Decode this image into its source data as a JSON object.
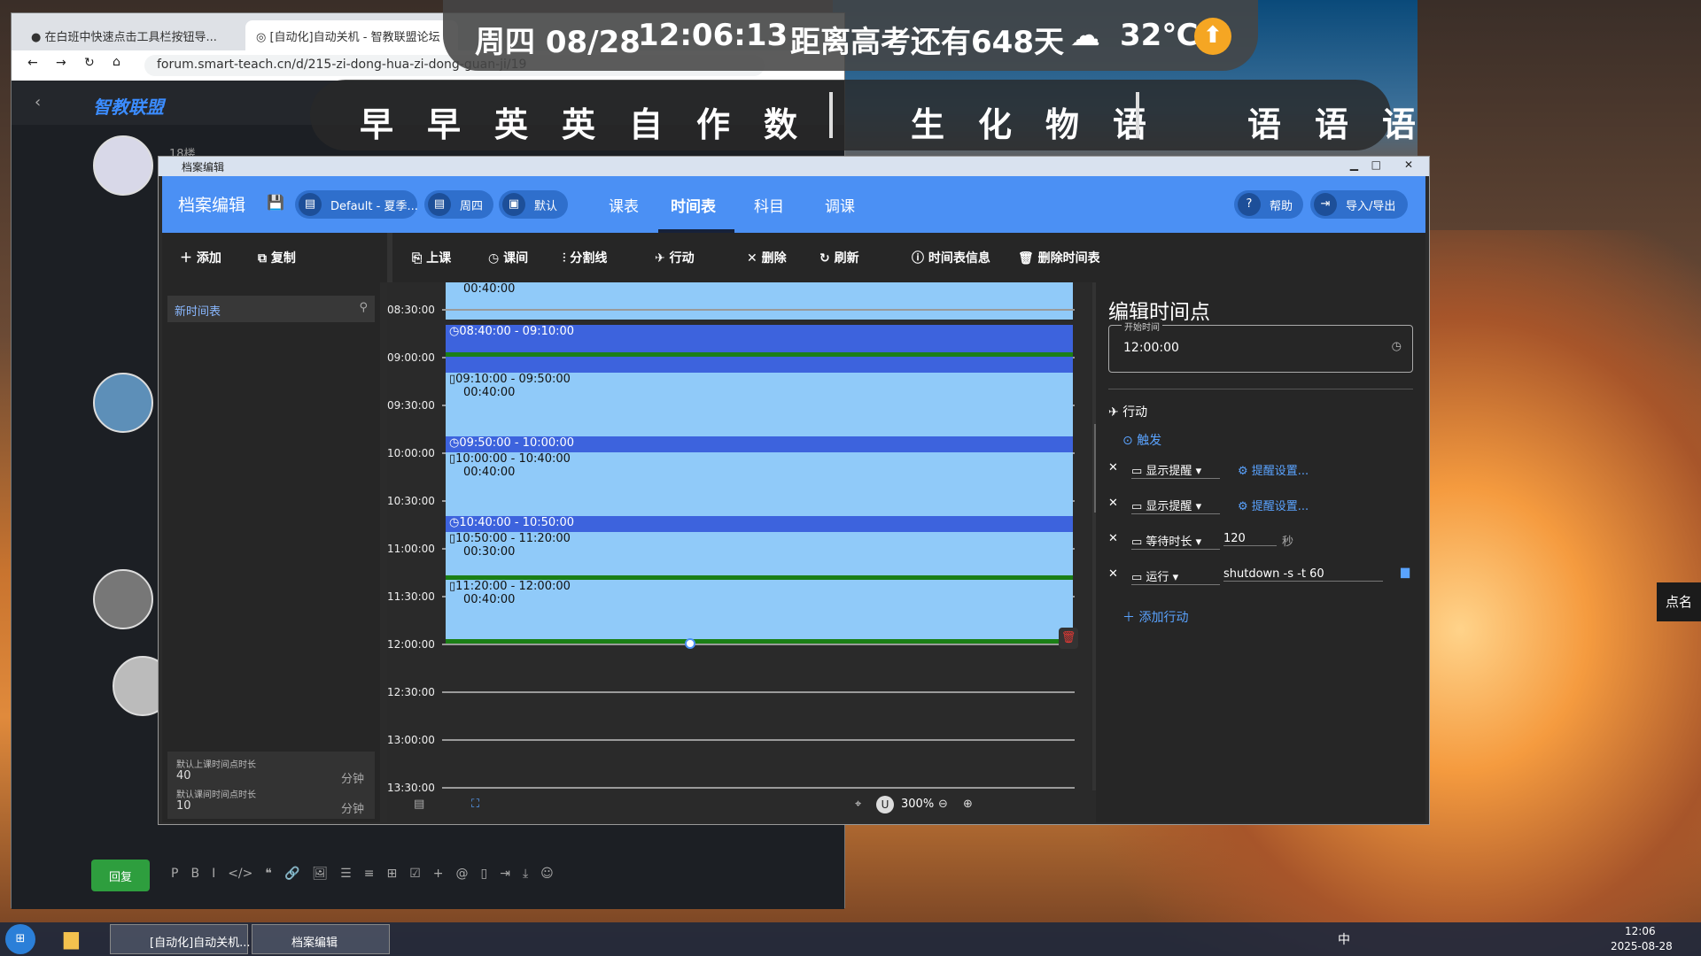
{
  "browser": {
    "tabs": [
      {
        "label": "在白班中快速点击工具栏按钮导..."
      },
      {
        "label": "[自动化]自动关机 - 智教联盟论坛"
      }
    ],
    "url": "forum.smart-teach.cn/d/215-zi-dong-hua-zi-dong-guan-ji/19",
    "forum_logo": "智教联盟",
    "floor": "18楼",
    "reply_label": "回复",
    "editor_tools": [
      "P",
      "B",
      "I",
      "</>",
      "❝",
      "🔗",
      "🖼",
      "☰",
      "≡",
      "⊞",
      "☑",
      "+",
      "@",
      "▯",
      "⇥",
      "⤓",
      "☺"
    ]
  },
  "topbar": {
    "date": "周四 08/28",
    "time": "12:06:13",
    "countdown": "距离高考还有648天",
    "weather": "32℃"
  },
  "subjects": [
    "早",
    "早",
    "英",
    "英",
    "自",
    "作",
    "数",
    "生",
    "化",
    "物",
    "语",
    "语",
    "语",
    "语"
  ],
  "window": {
    "title": "档案编辑",
    "header": {
      "title": "档案编辑",
      "profile": "Default - 夏季...",
      "day": "周四",
      "default_label": "默认",
      "tabs": [
        "课表",
        "时间表",
        "科目",
        "调课"
      ],
      "help": "帮助",
      "import_export": "导入/导出"
    },
    "side_toolbar": {
      "add": "添加",
      "copy": "复制"
    },
    "toolbar": {
      "class": "上课",
      "break": "课间",
      "divider": "分割线",
      "action": "行动",
      "delete": "删除",
      "refresh": "刷新",
      "info": "时间表信息",
      "delete_table": "删除时间表"
    },
    "sidebar": {
      "item": "新时间表",
      "default_class_label": "默认上课时间点时长",
      "default_class_value": "40",
      "default_break_label": "默认课间时间点时长",
      "default_break_value": "10",
      "unit": "分钟"
    },
    "timeline": {
      "times": [
        "08:30:00",
        "09:00:00",
        "09:30:00",
        "10:00:00",
        "10:30:00",
        "11:00:00",
        "11:30:00",
        "12:00:00",
        "12:30:00",
        "13:00:00",
        "13:30:00"
      ],
      "top_duration": "00:40:00",
      "blocks": [
        {
          "range": "08:40:00 - 09:10:00",
          "kind": "break"
        },
        {
          "range": "09:10:00 - 09:50:00",
          "dur": "00:40:00",
          "kind": "class"
        },
        {
          "range": "09:50:00 - 10:00:00",
          "kind": "break"
        },
        {
          "range": "10:00:00 - 10:40:00",
          "dur": "00:40:00",
          "kind": "class"
        },
        {
          "range": "10:40:00 - 10:50:00",
          "kind": "break"
        },
        {
          "range": "10:50:00 - 11:20:00",
          "dur": "00:30:00",
          "kind": "class"
        },
        {
          "range": "11:20:00 - 12:00:00",
          "dur": "00:40:00",
          "kind": "class"
        }
      ],
      "zoom": "300%"
    },
    "edit_panel": {
      "title": "编辑时间点",
      "start_label": "开始时间",
      "start_value": "12:00:00",
      "section": "行动",
      "trigger": "触发",
      "actions": [
        {
          "name": "显示提醒",
          "extra": "提醒设置..."
        },
        {
          "name": "显示提醒",
          "extra": "提醒设置..."
        },
        {
          "name": "等待时长",
          "value": "120",
          "unit": "秒"
        },
        {
          "name": "运行",
          "value": "shutdown -s -t 60"
        }
      ],
      "add_action": "添加行动"
    }
  },
  "right_button": "点名",
  "taskbar": {
    "chrome_label": "[自动化]自动关机...",
    "editor_label": "档案编辑",
    "clock_time": "12:06",
    "clock_date": "2025-08-28",
    "ime": "中"
  }
}
